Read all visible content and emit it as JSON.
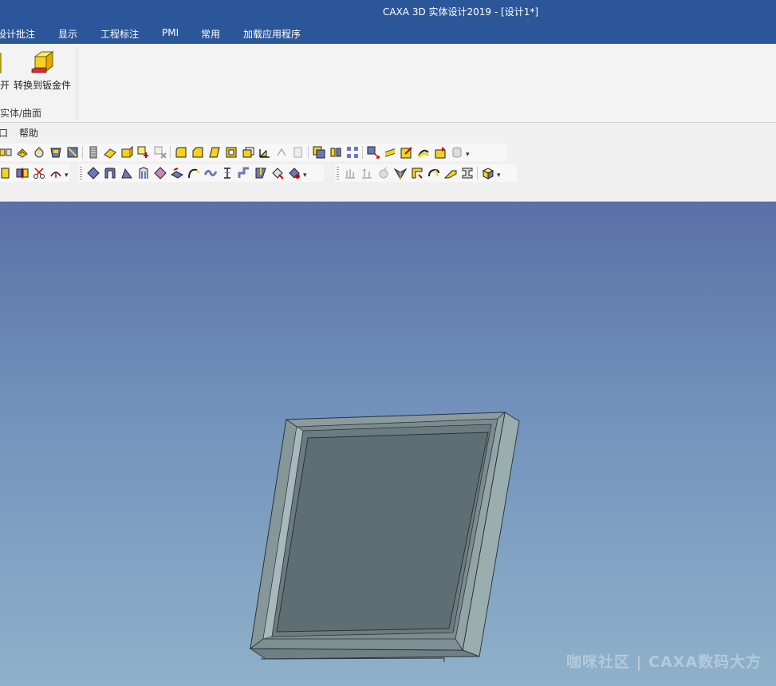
{
  "app": {
    "title": "CAXA 3D 实体设计2019 - [设计1*]"
  },
  "menubar": {
    "tabs": [
      "设计批注",
      "显示",
      "工程标注",
      "PMI",
      "常用",
      "加载应用程序"
    ]
  },
  "ribbon": {
    "partial_button_label": "开",
    "convert_button_label": "转换到钣金件",
    "group_label": "实体/曲面"
  },
  "classic_menu": {
    "items": [
      "口",
      "帮助"
    ]
  },
  "colors": {
    "titlebar": "#2b579a",
    "ribbon_bg": "#f3f3f3",
    "viewport_top": "#5b6fa6",
    "viewport_bottom": "#8fb1c9",
    "model_face": "#5e6f74",
    "model_frame": "#7b8b8e",
    "model_side": "#9aaeb0",
    "icon_yellow": "#f4d21f"
  },
  "watermark": {
    "text": "咖咪社区 | CAXA数码大方"
  }
}
